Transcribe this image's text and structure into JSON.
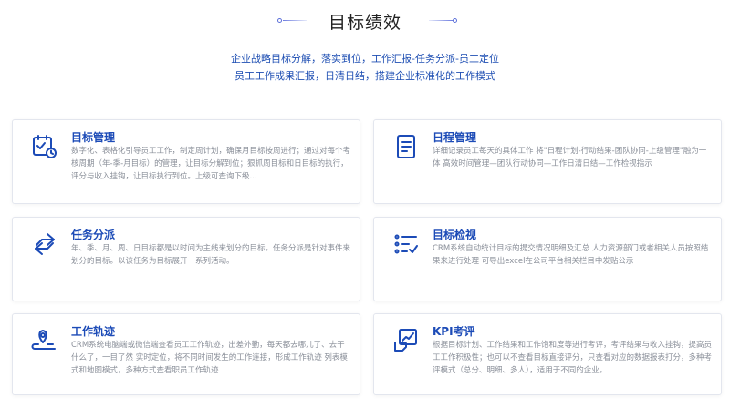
{
  "header": {
    "title": "目标绩效",
    "subtitle_line1": "企业战略目标分解，落实到位，工作汇报-任务分派-员工定位",
    "subtitle_line2": "员工工作成果汇报，日清日结，搭建企业标准化的工作模式"
  },
  "colors": {
    "accent": "#1c4bb7",
    "subtitle": "#1f4fb3",
    "description": "#8a8f99",
    "card_border": "#e3e6ee"
  },
  "cards": [
    {
      "icon": "calendar-check-icon",
      "title": "目标管理",
      "description": "数字化、表格化引导员工工作，制定周计划，确保月目标按周进行；通过对每个考核周期（年-季-月目标）的管理，让目标分解到位；狠抓周目标和日目标的执行，评分与收入挂钩，让目标执行到位。上级可查询下级..."
    },
    {
      "icon": "document-list-icon",
      "title": "日程管理",
      "description": "详细记录员工每天的具体工作 将\"日程计划-行动结果-团队协同-上级管理\"融为一体 高效时间管理—团队行动协同—工作日清日结—工作检视指示"
    },
    {
      "icon": "swap-arrows-icon",
      "title": "任务分派",
      "description": "年、季、月、周、日目标都是以时间为主线来划分的目标。任务分派是针对事件来划分的目标。以该任务为目标展开一系列活动。"
    },
    {
      "icon": "checklist-icon",
      "title": "目标检视",
      "description": "CRM系统自动统计目标的提交情况明细及汇总 人力资源部门或者相关人员按照结果来进行处理 可导出excel在公司平台相关栏目中发贴公示"
    },
    {
      "icon": "route-pin-icon",
      "title": "工作轨迹",
      "description": "CRM系统电脑端或微信端查看员工工作轨迹，出差外勤，每天都去哪儿了、去干什么了，一目了然 实时定位，将不同时间发生的工作连接，形成工作轨迹 列表模式和地图模式，多种方式查看职员工作轨迹"
    },
    {
      "icon": "chart-evaluation-icon",
      "title": "KPI考评",
      "description": "根据目标计划、工作结果和工作饱和度等进行考评，考评结果与收入挂钩，提高员工工作积极性；也可以不查看目标直接评分，只查看对应的数据报表打分，多种考评模式（总分、明细、多人），适用于不同的企业。"
    }
  ]
}
